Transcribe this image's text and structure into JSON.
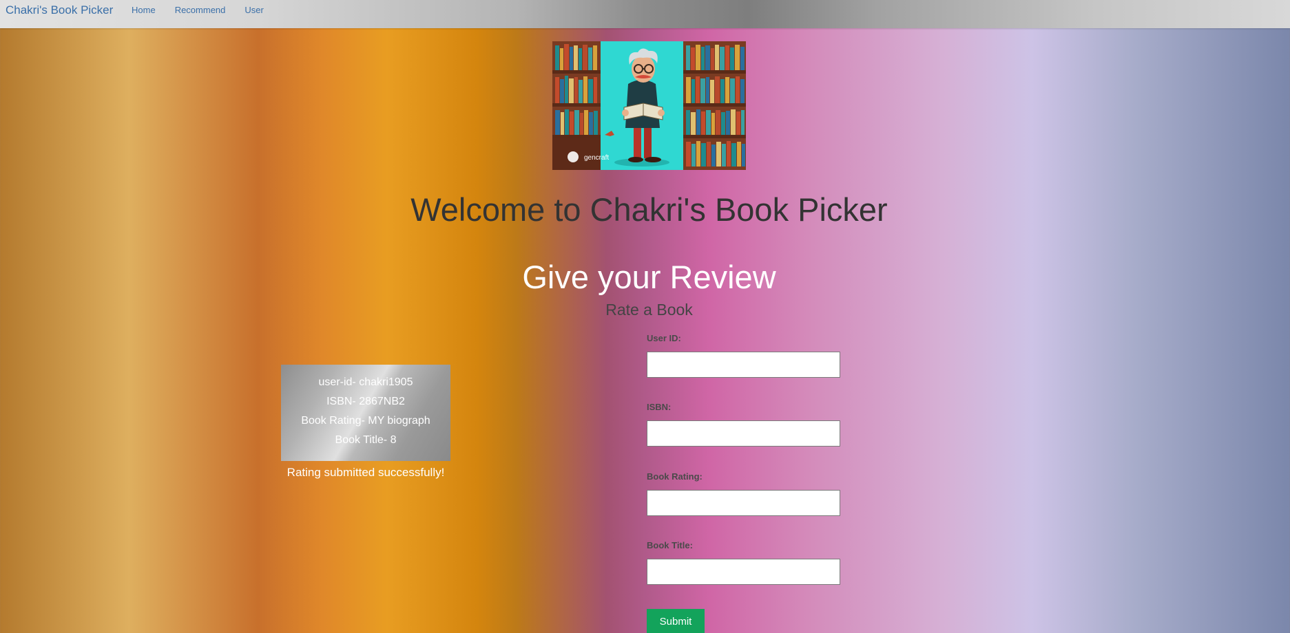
{
  "nav": {
    "brand": "Chakri's Book Picker",
    "links": [
      "Home",
      "Recommend",
      "User"
    ]
  },
  "hero": {
    "image_caption": "gencraft"
  },
  "headings": {
    "welcome": "Welcome to Chakri's Book Picker",
    "review_title": "Give your Review",
    "rate_subtitle": "Rate a Book"
  },
  "info_card": {
    "lines": [
      "user-id- chakri1905",
      "ISBN- 2867NB2",
      "Book Rating- MY biograph",
      "Book Title- 8"
    ],
    "status": "Rating submitted successfully!"
  },
  "form": {
    "fields": [
      {
        "label": "User ID:",
        "value": ""
      },
      {
        "label": "ISBN:",
        "value": ""
      },
      {
        "label": "Book Rating:",
        "value": ""
      },
      {
        "label": "Book Title:",
        "value": ""
      }
    ],
    "submit_label": "Submit"
  },
  "colors": {
    "link": "#3a6fa8",
    "submit": "#13a35b"
  }
}
